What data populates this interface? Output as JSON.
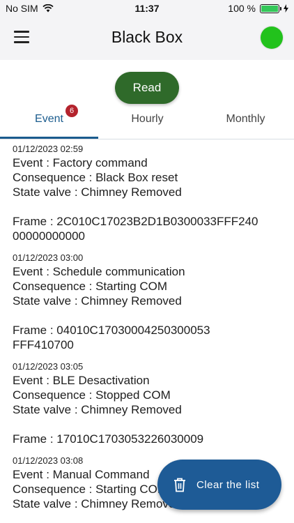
{
  "status_bar": {
    "carrier": "No SIM",
    "time": "11:37",
    "battery": "100 %"
  },
  "app_bar": {
    "title": "Black Box",
    "indicator_color": "#22c21c"
  },
  "read_button": {
    "label": "Read"
  },
  "tabs": [
    {
      "label": "Event",
      "badge": "6",
      "active": true
    },
    {
      "label": "Hourly",
      "active": false
    },
    {
      "label": "Monthly",
      "active": false
    }
  ],
  "entries": [
    {
      "date": "01/12/2023 02:59",
      "event": "Event : Factory command",
      "consequence": "Consequence : Black Box reset",
      "state": "State valve : Chimney Removed",
      "frame": "Frame : 2C010C17023B2D1B0300033FFF24000000000000"
    },
    {
      "date": "01/12/2023 03:00",
      "event": "Event : Schedule communication",
      "consequence": "Consequence : Starting COM",
      "state": "State valve : Chimney Removed",
      "frame": "Frame : 04010C17030004250300053FFF410700"
    },
    {
      "date": "01/12/2023 03:05",
      "event": "Event : BLE Desactivation",
      "consequence": "Consequence : Stopped COM",
      "state": "State valve : Chimney Removed",
      "frame": "Frame : 17010C1703053226030009"
    },
    {
      "date": "01/12/2023 03:08",
      "event": "Event : Manual Command",
      "consequence": "Consequence : Starting COM",
      "state": "State valve : Chimney Removed",
      "frame": ""
    }
  ],
  "fab": {
    "label": "Clear the list",
    "icon": "trash-icon"
  },
  "colors": {
    "accent": "#1b5c8e",
    "read_button": "#2f6a2a",
    "badge": "#b4232d",
    "fab": "#1e5b96"
  }
}
